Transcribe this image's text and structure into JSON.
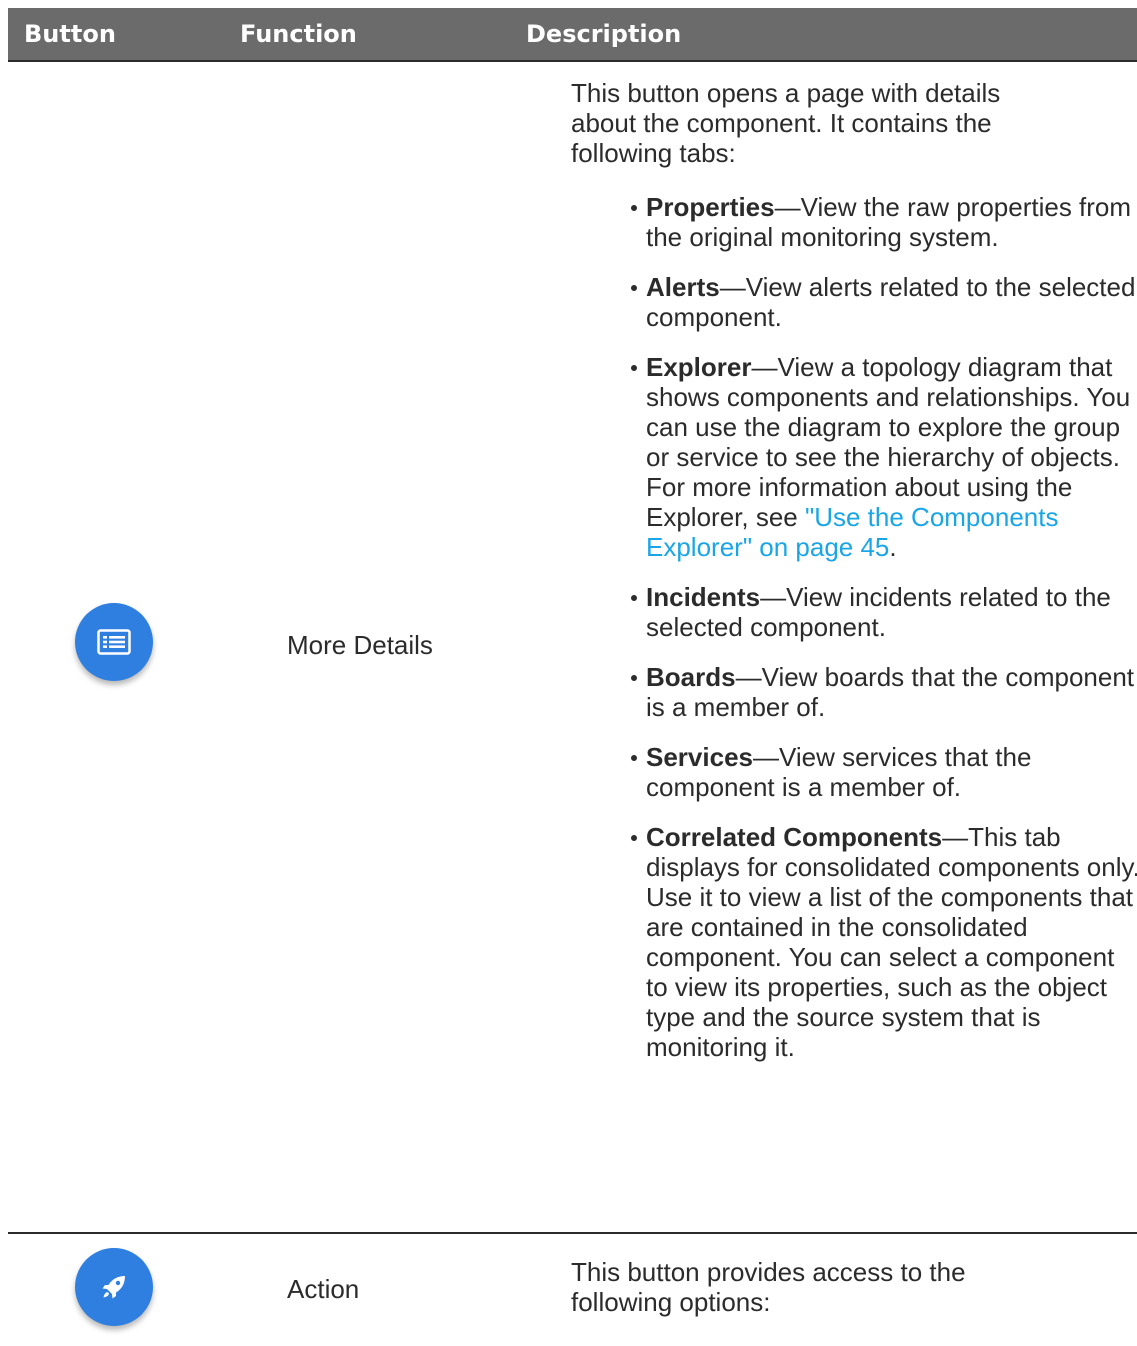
{
  "header": {
    "col_button": "Button",
    "col_function": "Function",
    "col_description": "Description"
  },
  "rows": [
    {
      "icon": "list-details-icon",
      "function": "More Details",
      "intro": "This button opens a page with details about the component. It contains the following tabs:",
      "tabs": [
        {
          "name": "Properties",
          "text": "—View the raw properties from the original monitoring system."
        },
        {
          "name": "Alerts",
          "text": "—View alerts related to the selected component."
        },
        {
          "name": "Explorer",
          "text": "—View a topology diagram that shows components and relationships. You can use the diagram to explore the group or service to see the hierarchy of objects. For more information about using the Explorer, see ",
          "link": "\"Use the Components Explorer\" on page 45",
          "after": "."
        },
        {
          "name": "Incidents",
          "text": "—View incidents related to the selected component."
        },
        {
          "name": "Boards",
          "text": "—View boards that the component is a member of."
        },
        {
          "name": "Services",
          "text": "—View services that the component is a member of."
        },
        {
          "name": "Correlated Components",
          "text": "—This tab displays for consolidated components only. Use it to view a list of the components that are contained in the consolidated component. You can select a component to view its properties, such as the object type and the source system that is monitoring it."
        }
      ]
    },
    {
      "icon": "rocket-icon",
      "function": "Action",
      "intro": "This button provides access to the following options:"
    }
  ],
  "colors": {
    "header_bg": "#6b6b6b",
    "icon_button": "#2f7fe0",
    "link": "#1aa6e6",
    "text": "#2b2b2b"
  }
}
